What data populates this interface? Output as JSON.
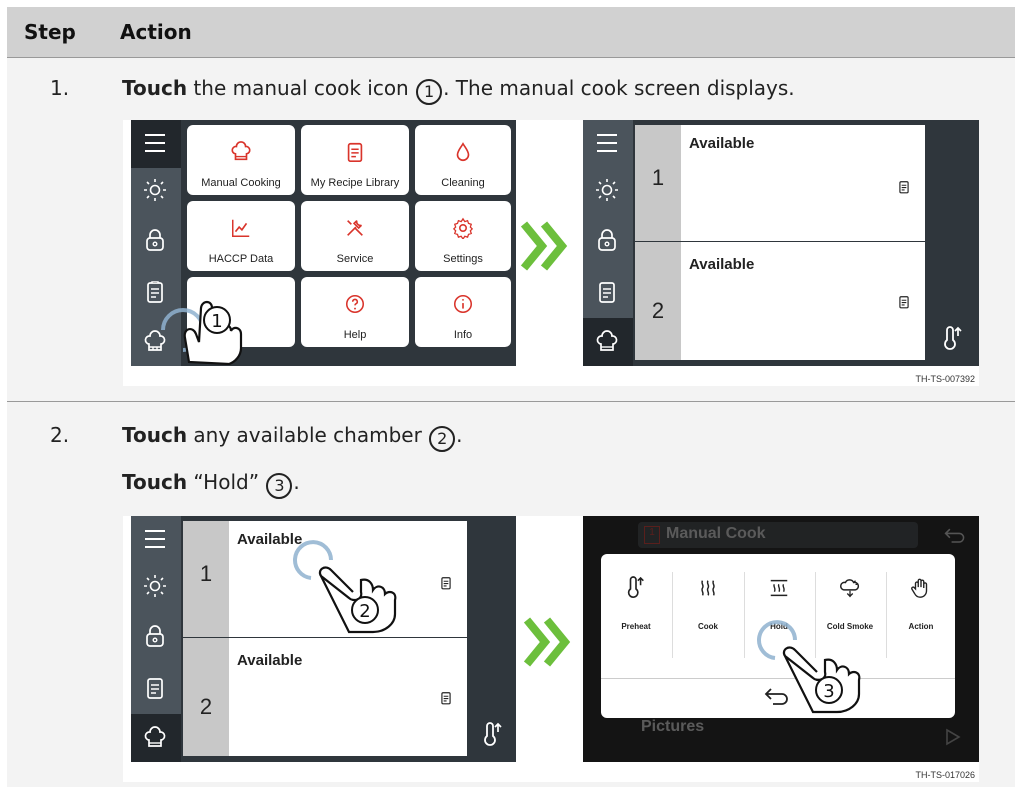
{
  "header": {
    "step": "Step",
    "action": "Action"
  },
  "steps": [
    {
      "num": "1.",
      "verb": "Touch",
      "text_a": " the manual cook icon ",
      "callout": "1",
      "text_b": ". The manual cook screen displays."
    },
    {
      "num": "2.",
      "line1": {
        "verb": "Touch",
        "text_a": " any available chamber ",
        "callout": "2",
        "text_b": "."
      },
      "line2": {
        "verb": "Touch",
        "text_a": " “Hold” ",
        "callout": "3",
        "text_b": "."
      }
    }
  ],
  "figure1": {
    "id": "TH-TS-007392",
    "home_tiles": [
      {
        "label": "Manual Cooking",
        "icon": "chef-hat-icon",
        "color": "#d9342b"
      },
      {
        "label": "My Recipe Library",
        "icon": "recipe-list-icon",
        "color": "#d9342b"
      },
      {
        "label": "Cleaning",
        "icon": "water-drop-icon",
        "color": "#d9342b"
      },
      {
        "label": "HACCP Data",
        "icon": "chart-line-icon",
        "color": "#d9342b"
      },
      {
        "label": "Service",
        "icon": "tools-icon",
        "color": "#d9342b"
      },
      {
        "label": "Settings",
        "icon": "gear-icon",
        "color": "#d9342b"
      },
      {
        "label": "Help",
        "icon": "help-icon",
        "color": "#d9342b"
      },
      {
        "label": "Info",
        "icon": "info-icon",
        "color": "#d9342b"
      }
    ],
    "chambers": [
      {
        "num": "1",
        "status": "Available"
      },
      {
        "num": "2",
        "status": "Available"
      }
    ],
    "callout": "1"
  },
  "figure2": {
    "id": "TH-TS-017026",
    "chambers": [
      {
        "num": "1",
        "status": "Available"
      },
      {
        "num": "2",
        "status": "Available"
      }
    ],
    "background": {
      "title_num": "1",
      "title": "Manual Cook",
      "bottom": "Pictures"
    },
    "options": [
      "Preheat",
      "Cook",
      "Hold",
      "Cold Smoke",
      "Action"
    ],
    "callout_chamber": "2",
    "callout_hold": "3"
  },
  "colors": {
    "accent_red": "#d9342b",
    "arrow_green": "#6cbf3c",
    "header_bg": "#d1d1d1",
    "row_bg": "#f3f3f3"
  }
}
